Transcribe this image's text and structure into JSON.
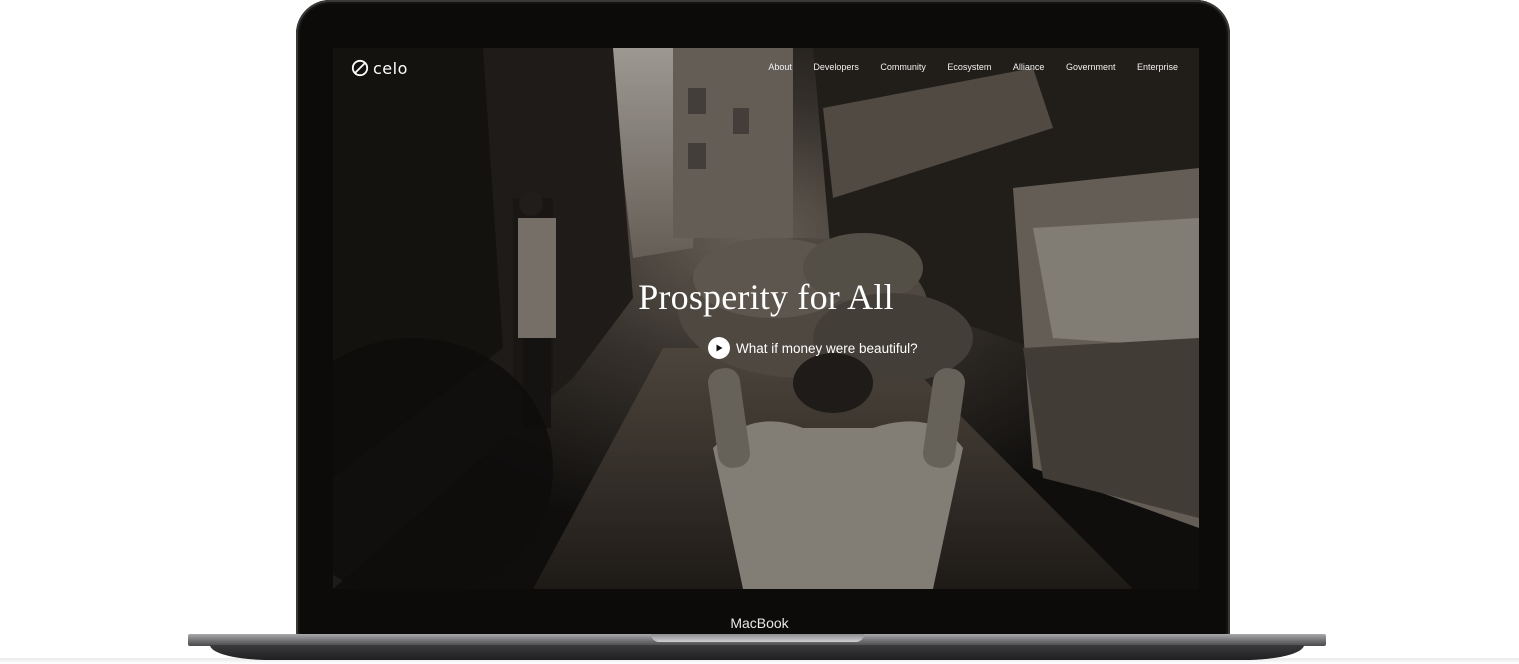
{
  "device": {
    "label": "MacBook"
  },
  "header": {
    "logo_text": "celo",
    "logo_icon": "celo-logo-icon",
    "nav": [
      {
        "label": "About"
      },
      {
        "label": "Developers"
      },
      {
        "label": "Community"
      },
      {
        "label": "Ecosystem"
      },
      {
        "label": "Alliance"
      },
      {
        "label": "Government"
      },
      {
        "label": "Enterprise"
      }
    ]
  },
  "hero": {
    "title": "Prosperity for All",
    "cta_label": "What if money were beautiful?",
    "cta_icon": "play-icon"
  },
  "colors": {
    "text": "#ffffff",
    "device_body": "#0c0b0a"
  }
}
